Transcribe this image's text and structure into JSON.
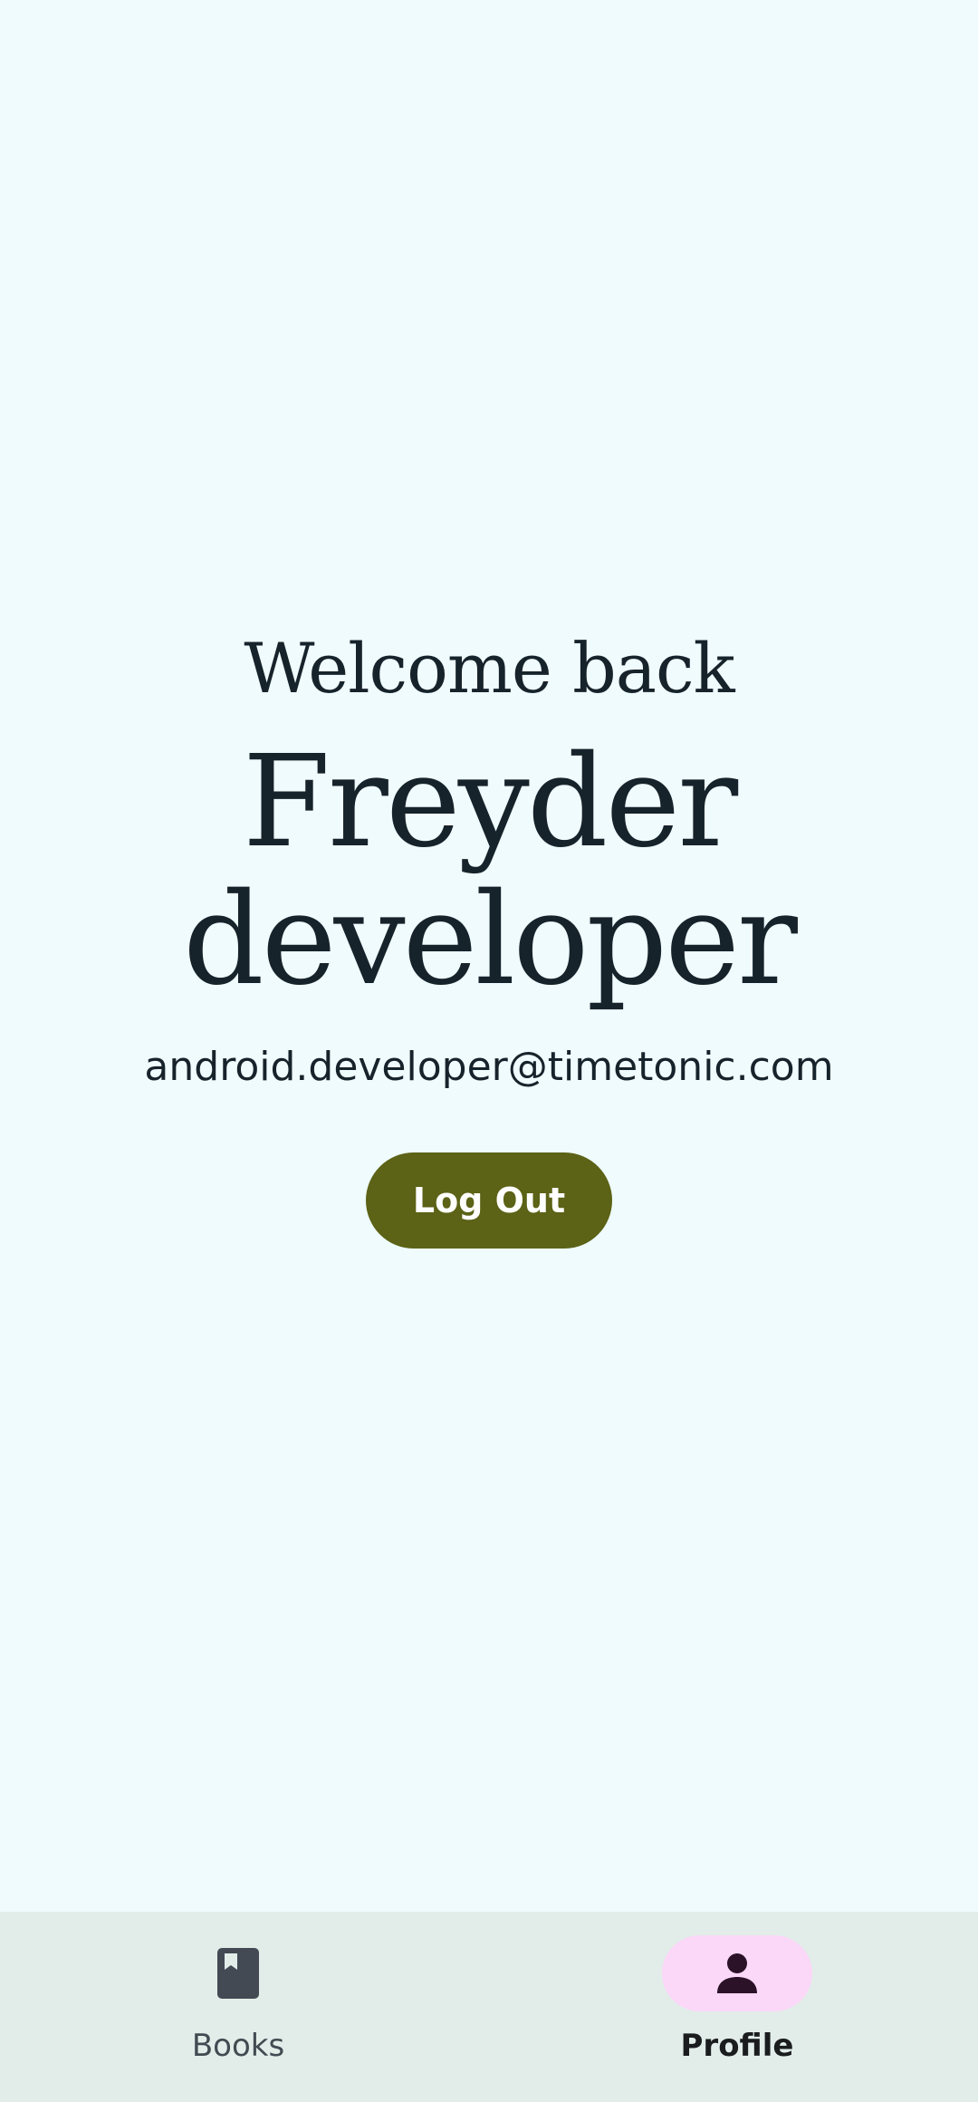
{
  "profile": {
    "greeting": "Welcome back",
    "name": "Freyder developer",
    "email": "android.developer@timetonic.com",
    "logout_label": "Log Out"
  },
  "nav": {
    "items": [
      {
        "label": "Books",
        "icon": "book-icon",
        "selected": false
      },
      {
        "label": "Profile",
        "icon": "person-icon",
        "selected": true
      }
    ]
  },
  "colors": {
    "background": "#EFFBFD",
    "primary_button": "#5c6216",
    "nav_background": "#e2ede9",
    "nav_active_indicator": "#fbd7f8",
    "text": "#17232b"
  }
}
